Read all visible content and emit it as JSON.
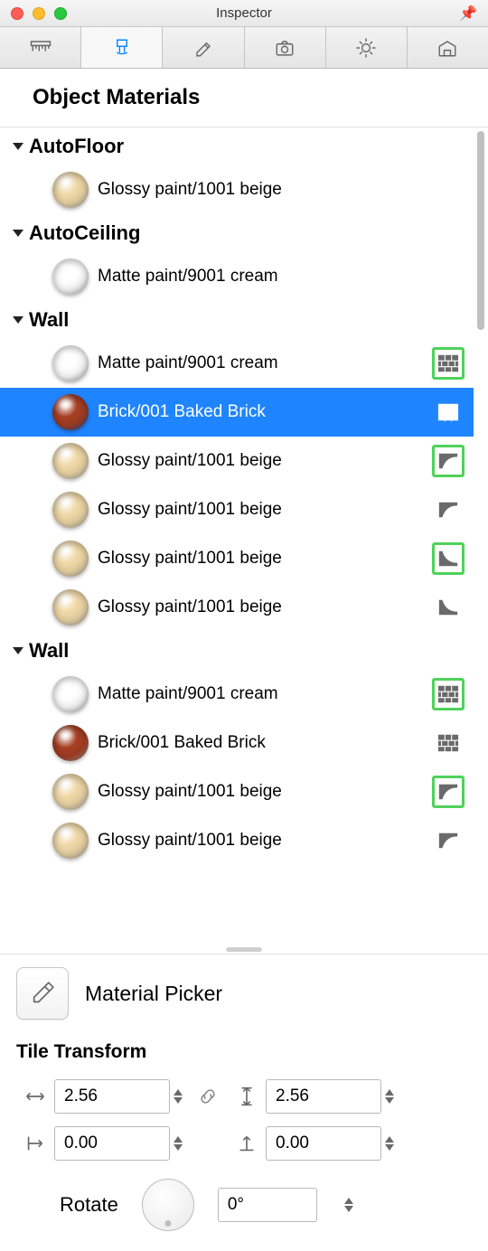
{
  "window": {
    "title": "Inspector"
  },
  "tabs": {
    "active_index": 1
  },
  "section_title": "Object Materials",
  "groups": [
    {
      "name": "AutoFloor",
      "items": [
        {
          "label": "Glossy paint/1001 beige",
          "swatch": "#f0d9a8",
          "tile": null,
          "tile_hl": false,
          "selected": false
        }
      ]
    },
    {
      "name": "AutoCeiling",
      "items": [
        {
          "label": "Matte paint/9001 cream",
          "swatch": "#ffffff",
          "tile": null,
          "tile_hl": false,
          "selected": false
        }
      ]
    },
    {
      "name": "Wall",
      "items": [
        {
          "label": "Matte paint/9001 cream",
          "swatch": "#ffffff",
          "tile": "brick",
          "tile_hl": true,
          "selected": false
        },
        {
          "label": "Brick/001 Baked Brick",
          "swatch": "#a73f24",
          "tile": "brick",
          "tile_hl": false,
          "selected": true
        },
        {
          "label": "Glossy paint/1001 beige",
          "swatch": "#f0d9a8",
          "tile": "crown",
          "tile_hl": true,
          "selected": false
        },
        {
          "label": "Glossy paint/1001 beige",
          "swatch": "#f0d9a8",
          "tile": "crown",
          "tile_hl": false,
          "selected": false
        },
        {
          "label": "Glossy paint/1001 beige",
          "swatch": "#f0d9a8",
          "tile": "base",
          "tile_hl": true,
          "selected": false
        },
        {
          "label": "Glossy paint/1001 beige",
          "swatch": "#f0d9a8",
          "tile": "base",
          "tile_hl": false,
          "selected": false
        }
      ]
    },
    {
      "name": "Wall",
      "items": [
        {
          "label": "Matte paint/9001 cream",
          "swatch": "#ffffff",
          "tile": "brick",
          "tile_hl": true,
          "selected": false
        },
        {
          "label": "Brick/001 Baked Brick",
          "swatch": "#a73f24",
          "tile": "brick",
          "tile_hl": false,
          "selected": false
        },
        {
          "label": "Glossy paint/1001 beige",
          "swatch": "#f0d9a8",
          "tile": "crown",
          "tile_hl": true,
          "selected": false
        },
        {
          "label": "Glossy paint/1001 beige",
          "swatch": "#f0d9a8",
          "tile": "crown",
          "tile_hl": false,
          "selected": false
        }
      ]
    }
  ],
  "material_picker": {
    "title": "Material Picker"
  },
  "tile_transform": {
    "title": "Tile Transform",
    "width": "2.56",
    "height": "2.56",
    "offset_x": "0.00",
    "offset_y": "0.00",
    "rotate_label": "Rotate",
    "rotate_value": "0°"
  },
  "colors": {
    "selection": "#1f84ff",
    "tile_highlight": "#4fd25a"
  }
}
